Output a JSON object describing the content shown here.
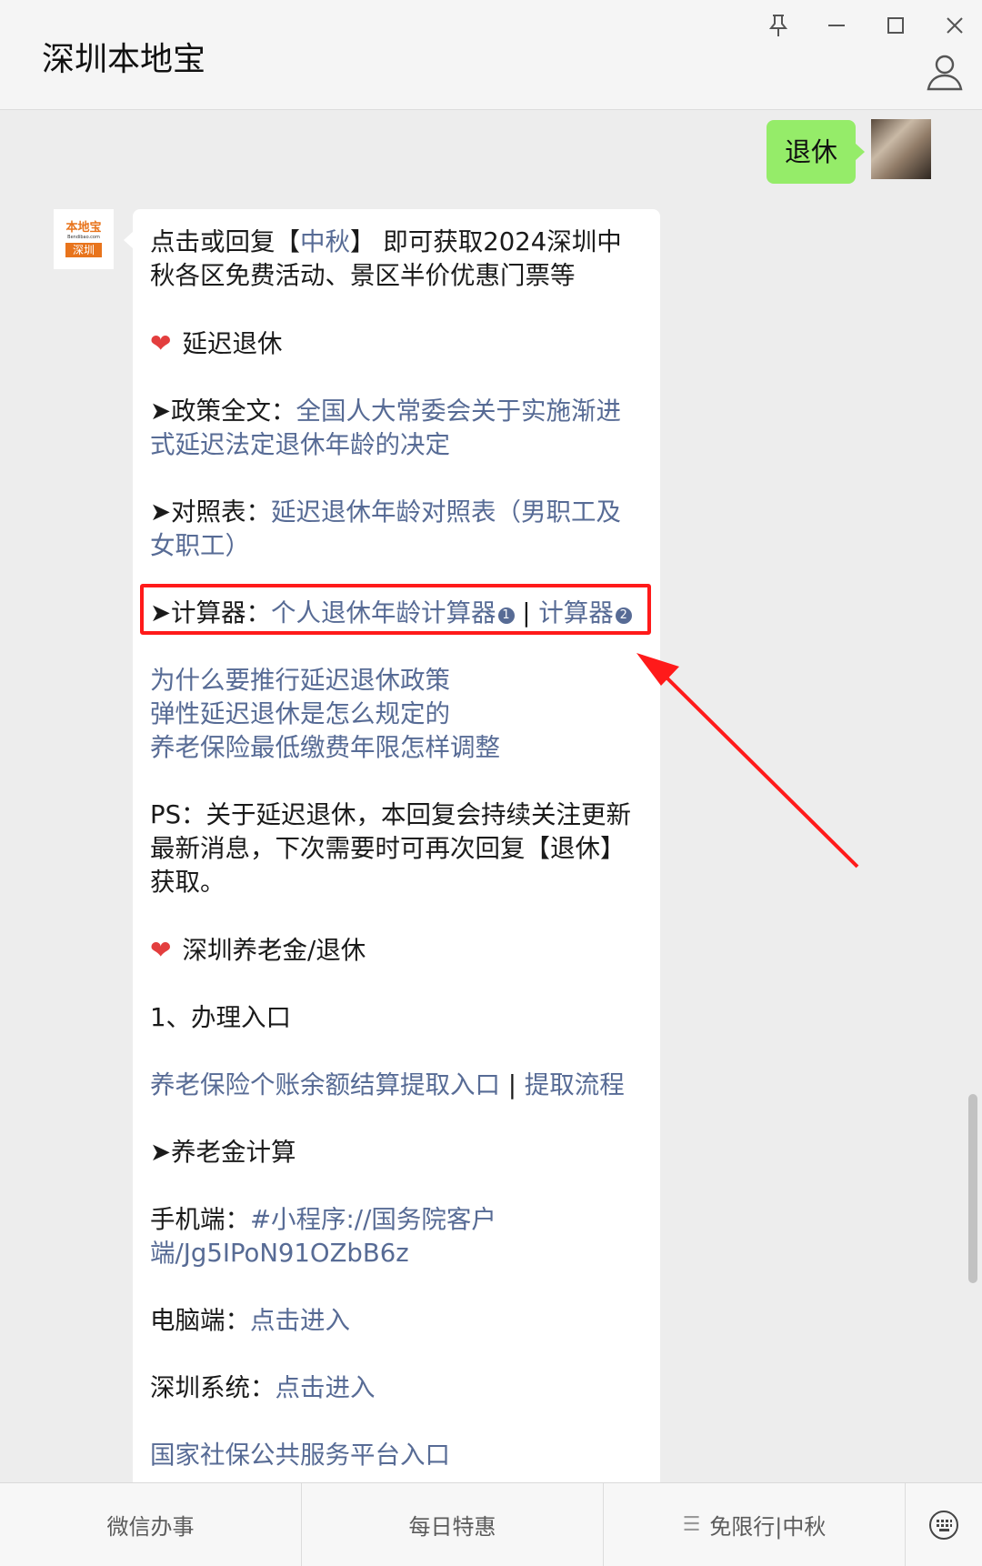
{
  "window": {
    "title": "深圳本地宝"
  },
  "user_message": {
    "text": "退休"
  },
  "account_logo": {
    "brand": "本地宝",
    "domain": "Bendibao.com",
    "city": "深圳"
  },
  "reply": {
    "intro_before": "点击或回复【",
    "intro_link": "中秋",
    "intro_after": "】 即可获取2024深圳中秋各区免费活动、景区半价优惠门票等",
    "section1_heading": "延迟退休",
    "policy_prefix": "➤政策全文：",
    "policy_link": "全国人大常委会关于实施渐进式延迟法定退休年龄的决定",
    "table_prefix": "➤对照表：",
    "table_link": "延迟退休年龄对照表（男职工及女职工）",
    "calc_prefix": "➤计算器：",
    "calc_link1": "个人退休年龄计算器",
    "calc_badge1": "1",
    "separator": " | ",
    "calc_link2": "计算器",
    "calc_badge2": "2",
    "faq_links": [
      "为什么要推行延迟退休政策",
      "弹性延迟退休是怎么规定的",
      "养老保险最低缴费年限怎样调整"
    ],
    "ps_text": "PS：关于延迟退休，本回复会持续关注更新最新消息，下次需要时可再次回复【退休】获取。",
    "section2_heading": "深圳养老金/退休",
    "item1_title": "1、办理入口",
    "withdraw_link": "养老保险个账余额结算提取入口",
    "withdraw_flow_link": "提取流程",
    "pension_calc_heading": "➤养老金计算",
    "mobile_label": "手机端：",
    "mobile_link": "#小程序://国务院客户端/Jg5IPoN91OZbB6z",
    "pc_label": "电脑端：",
    "pc_link": "点击进入",
    "sz_label": "深圳系统：",
    "sz_link": "点击进入",
    "national_link": "国家社保公共服务平台入口"
  },
  "menu": [
    "微信办事",
    "每日特惠",
    "免限行|中秋"
  ],
  "icons": [
    "pin-icon",
    "minimize-icon",
    "maximize-icon",
    "close-icon",
    "person-icon",
    "heart-icon",
    "menu-lines-icon",
    "keyboard-icon"
  ],
  "colors": {
    "link": "#576b95",
    "user_bubble": "#95ec69",
    "highlight": "#ff1a1a",
    "heart": "#e33e3e",
    "brand_orange": "#e8741c"
  }
}
